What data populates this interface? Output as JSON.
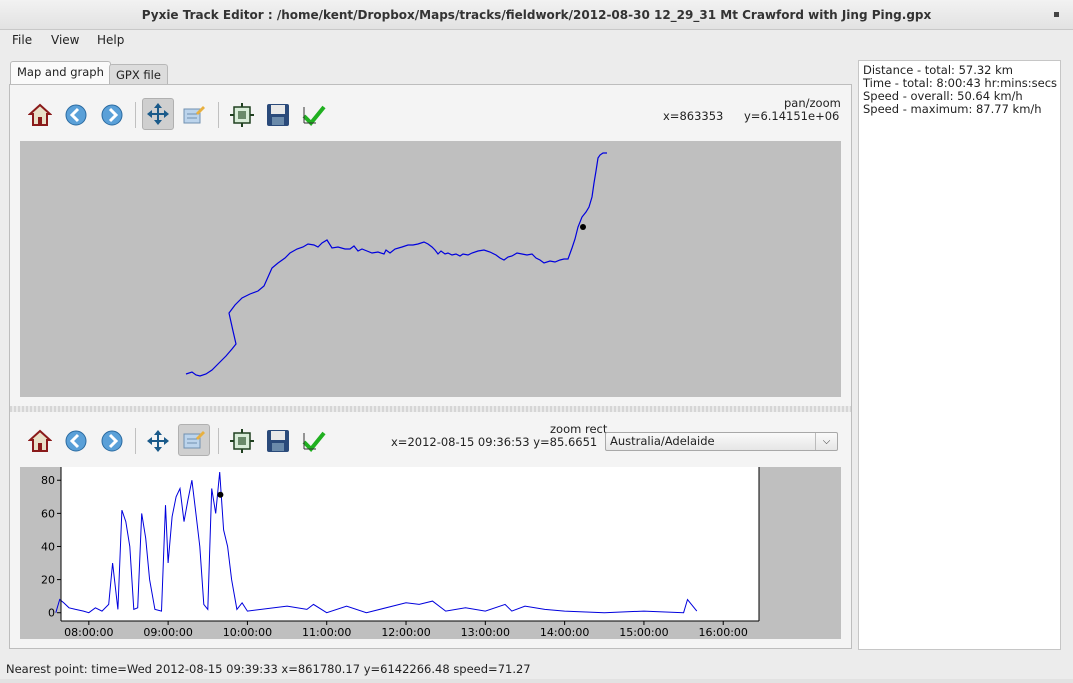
{
  "window": {
    "title": "Pyxie Track Editor : /home/kent/Dropbox/Maps/tracks/fieldwork/2012-08-30 12_29_31 Mt Crawford with Jing Ping.gpx"
  },
  "menu": {
    "file": "File",
    "view": "View",
    "help": "Help"
  },
  "tabs": [
    {
      "label": "Map and graph"
    },
    {
      "label": "GPX file"
    }
  ],
  "map_panel": {
    "mode": "pan/zoom",
    "x_readout": "x=863353",
    "y_readout": "y=6.14151e+06"
  },
  "graph_panel": {
    "mode": "zoom rect",
    "readout": "x=2012-08-15 09:36:53 y=85.6651",
    "timezone": "Australia/Adelaide"
  },
  "stats": [
    "Distance - total: 57.32 km",
    "Time - total: 8:00:43 hr:mins:secs",
    "Speed - overall: 50.64 km/h",
    "Speed - maximum: 87.77 km/h"
  ],
  "status": "Nearest point: time=Wed 2012-08-15 09:39:33 x=861780.17 y=6142266.48 speed=71.27",
  "colors": {
    "track": "#0000dd",
    "plot_bg": "#bfbfbf",
    "marker": "#000000"
  },
  "chart_data": {
    "type": "line",
    "xlabel": "",
    "ylabel": "",
    "x_ticks": [
      "08:00:00",
      "09:00:00",
      "10:00:00",
      "11:00:00",
      "12:00:00",
      "13:00:00",
      "14:00:00",
      "15:00:00",
      "16:00:00"
    ],
    "y_ticks": [
      "0",
      "20",
      "40",
      "60",
      "80"
    ],
    "ylim": [
      -5,
      88
    ],
    "marker": {
      "x": "09:39:33",
      "y": 71.27
    },
    "series": [
      {
        "x": [
          "07:35",
          "07:38",
          "07:41",
          "07:45",
          "07:50",
          "07:56",
          "08:00",
          "08:05",
          "08:10",
          "08:15",
          "08:18",
          "08:22",
          "08:25",
          "08:28",
          "08:31",
          "08:34",
          "08:37",
          "08:40",
          "08:43",
          "08:46",
          "08:50",
          "08:55",
          "08:58",
          "09:00",
          "09:03",
          "09:06",
          "09:09",
          "09:12",
          "09:15",
          "09:18",
          "09:21",
          "09:24",
          "09:27",
          "09:30",
          "09:33",
          "09:36",
          "09:39",
          "09:42",
          "09:45",
          "09:48",
          "09:52",
          "09:56",
          "10:00",
          "10:30",
          "10:45",
          "10:50",
          "11:00",
          "11:15",
          "11:30",
          "12:00",
          "12:10",
          "12:20",
          "12:30",
          "12:45",
          "13:00",
          "13:15",
          "13:20",
          "13:30",
          "13:45",
          "14:00",
          "14:30",
          "15:00",
          "15:30",
          "15:33",
          "15:40"
        ],
        "values": [
          0,
          8,
          6,
          3,
          2,
          1,
          0,
          3,
          1,
          5,
          30,
          2,
          62,
          55,
          40,
          2,
          3,
          60,
          45,
          20,
          2,
          1,
          65,
          30,
          58,
          70,
          75,
          55,
          68,
          80,
          60,
          40,
          5,
          2,
          75,
          60,
          85,
          50,
          40,
          20,
          2,
          6,
          1,
          4,
          2,
          5,
          0,
          4,
          0,
          6,
          5,
          7,
          1,
          3,
          1,
          5,
          1,
          4,
          2,
          1,
          0,
          1,
          0,
          8,
          1
        ]
      }
    ]
  }
}
